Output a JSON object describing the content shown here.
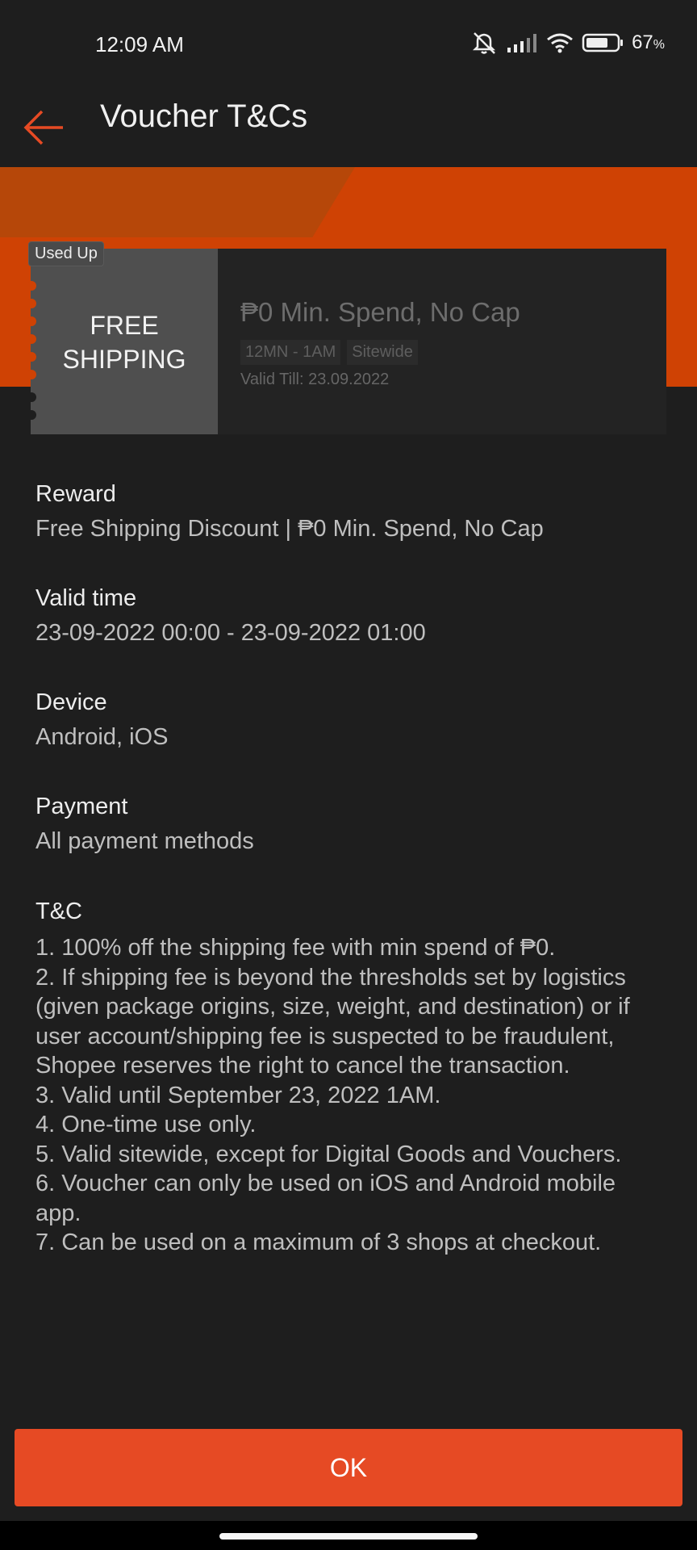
{
  "status_bar": {
    "time": "12:09 AM",
    "battery_pct": "67",
    "battery_unit": "%",
    "icons": [
      "mute-icon",
      "signal-icon",
      "wifi-icon",
      "battery-icon"
    ]
  },
  "header": {
    "title": "Voucher T&Cs",
    "back_icon": "back-arrow-icon"
  },
  "voucher": {
    "left_line1": "FREE",
    "left_line2": "SHIPPING",
    "badge": "Used Up",
    "title": "₱0 Min. Spend, No Cap",
    "tags": [
      "12MN - 1AM",
      "Sitewide"
    ],
    "valid_till": "Valid Till: 23.09.2022"
  },
  "details": {
    "reward_label": "Reward",
    "reward_value": "Free Shipping Discount | ₱0 Min. Spend, No Cap",
    "valid_label": "Valid time",
    "valid_value": "23-09-2022 00:00 - 23-09-2022 01:00",
    "device_label": "Device",
    "device_value": "Android, iOS",
    "payment_label": "Payment",
    "payment_value": "All payment methods",
    "tc_label": "T&C",
    "tc_items": [
      "1. 100% off the shipping fee with min spend of ₱0.",
      "2. If shipping fee is beyond the thresholds set by logistics (given package origins, size, weight, and destination) or if user account/shipping fee is suspected to be fraudulent, Shopee reserves the right to cancel the transaction.",
      "3. Valid until September 23, 2022 1AM.",
      "4. One-time use only.",
      "5. Valid sitewide, except for Digital Goods and Vouchers.",
      "6. Voucher can only be used on iOS and Android mobile app.",
      "7. Can be used on a maximum of 3 shops at checkout."
    ]
  },
  "footer": {
    "ok_label": "OK"
  },
  "colors": {
    "accent": "#e64a24",
    "banner": "#cf4204",
    "background": "#1e1e1e"
  }
}
